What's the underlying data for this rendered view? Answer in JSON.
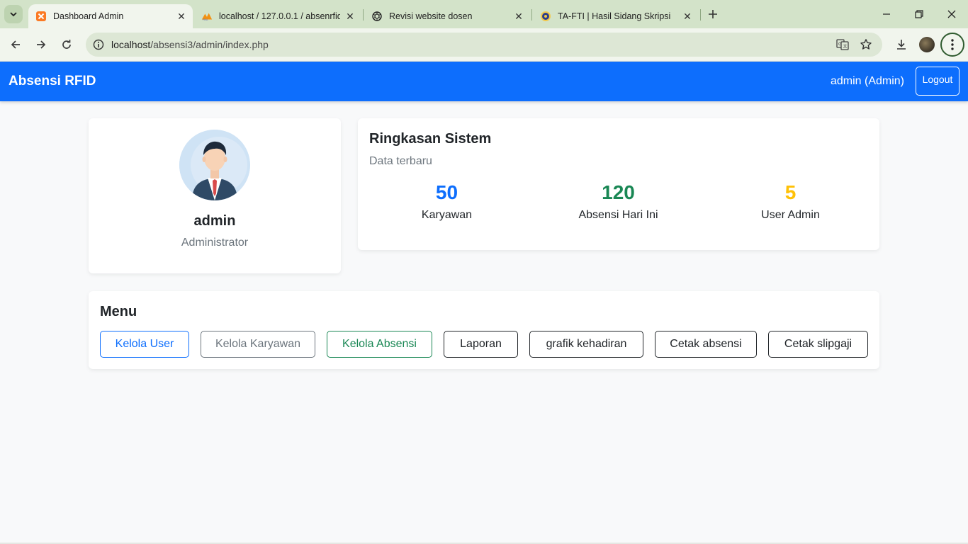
{
  "browser": {
    "tabs": [
      {
        "title": "Dashboard Admin",
        "active": true,
        "favicon": "xampp-icon"
      },
      {
        "title": "localhost / 127.0.0.1 / absenrfid",
        "active": false,
        "favicon": "phpmyadmin-icon"
      },
      {
        "title": "Revisi website dosen",
        "active": false,
        "favicon": "chatgpt-icon"
      },
      {
        "title": "TA-FTI | Hasil Sidang Skripsi",
        "active": false,
        "favicon": "university-icon"
      }
    ],
    "address": {
      "host": "localhost",
      "path": "/absensi3/admin/index.php"
    }
  },
  "navbar": {
    "brand": "Absensi RFID",
    "user": "admin (Admin)",
    "logout": "Logout"
  },
  "profile": {
    "name": "admin",
    "role": "Administrator"
  },
  "summary": {
    "title": "Ringkasan Sistem",
    "subtitle": "Data terbaru",
    "stats": [
      {
        "value": "50",
        "label": "Karyawan",
        "color": "#0d6efd"
      },
      {
        "value": "120",
        "label": "Absensi Hari Ini",
        "color": "#198754"
      },
      {
        "value": "5",
        "label": "User Admin",
        "color": "#ffc107"
      }
    ]
  },
  "menu": {
    "title": "Menu",
    "buttons": [
      {
        "label": "Kelola User",
        "style": "primary"
      },
      {
        "label": "Kelola Karyawan",
        "style": "secondary"
      },
      {
        "label": "Kelola Absensi",
        "style": "success"
      },
      {
        "label": "Laporan",
        "style": "dark"
      },
      {
        "label": "grafik kehadiran",
        "style": "dark"
      },
      {
        "label": "Cetak absensi",
        "style": "dark"
      },
      {
        "label": "Cetak slipgaji",
        "style": "dark"
      }
    ]
  }
}
